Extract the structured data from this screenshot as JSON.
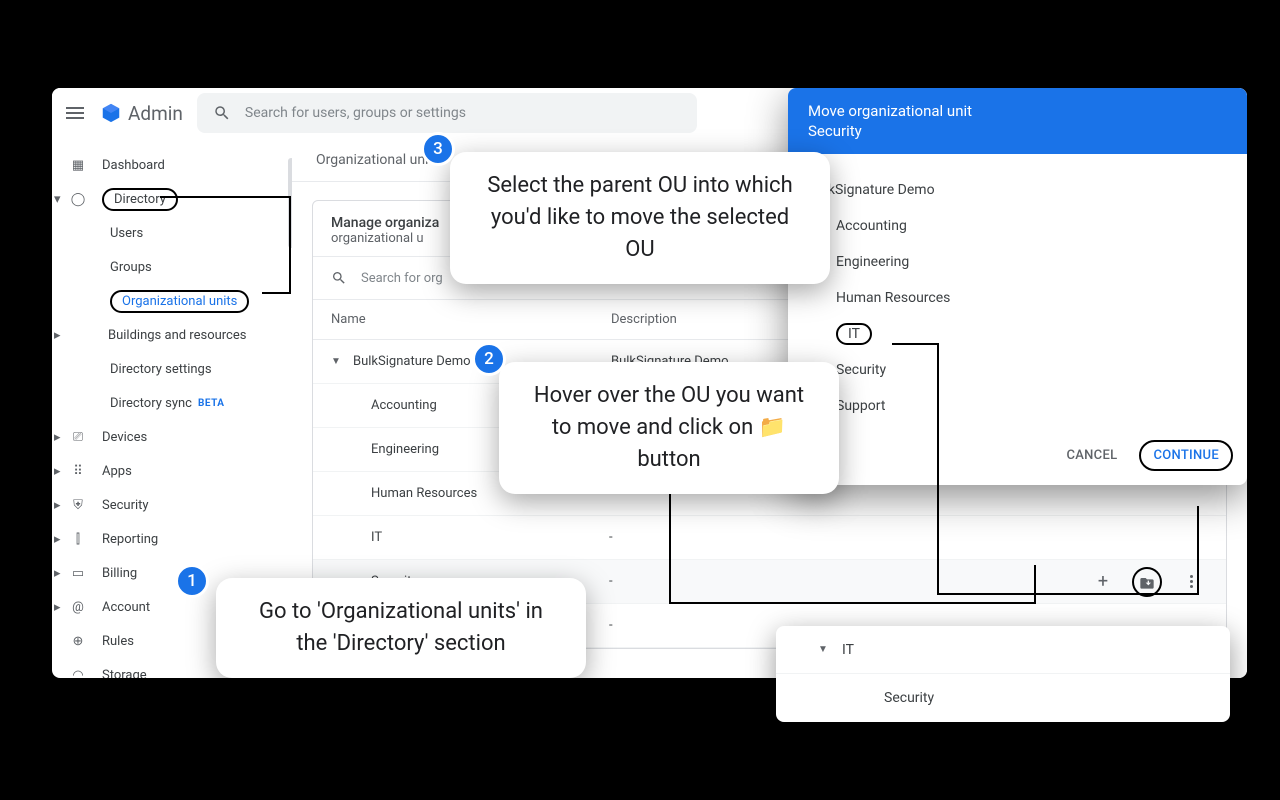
{
  "header": {
    "brand": "Admin",
    "search_placeholder": "Search for users, groups or settings"
  },
  "sidebar": {
    "items": [
      {
        "label": "Dashboard"
      },
      {
        "label": "Directory"
      },
      {
        "label": "Users"
      },
      {
        "label": "Groups"
      },
      {
        "label": "Organizational units"
      },
      {
        "label": "Buildings and resources"
      },
      {
        "label": "Directory settings"
      },
      {
        "label": "Directory sync",
        "badge": "BETA"
      },
      {
        "label": "Devices"
      },
      {
        "label": "Apps"
      },
      {
        "label": "Security"
      },
      {
        "label": "Reporting"
      },
      {
        "label": "Billing"
      },
      {
        "label": "Account"
      },
      {
        "label": "Rules"
      },
      {
        "label": "Storage"
      }
    ]
  },
  "main": {
    "breadcrumb": "Organizational units",
    "panel_title": "Manage organiza",
    "panel_sub": "organizational u",
    "search_placeholder": "Search for org",
    "cols": {
      "name": "Name",
      "desc": "Description"
    },
    "rows": [
      {
        "name": "BulkSignature Demo",
        "desc": "BulkSignature Demo",
        "level": 1,
        "exp": true
      },
      {
        "name": "Accounting",
        "desc": "",
        "level": 2
      },
      {
        "name": "Engineering",
        "desc": "",
        "level": 2
      },
      {
        "name": "Human Resources",
        "desc": "",
        "level": 2
      },
      {
        "name": "IT",
        "desc": "-",
        "level": 2
      },
      {
        "name": "Security",
        "desc": "-",
        "level": 2,
        "hover": true
      },
      {
        "name": "",
        "desc": "-",
        "level": 2
      }
    ]
  },
  "dialog": {
    "title": "Move organizational unit",
    "subtitle": "Security",
    "items": [
      "BulkSignature Demo",
      "Accounting",
      "Engineering",
      "Human Resources",
      "IT",
      "Security",
      "Support"
    ],
    "cancel": "CANCEL",
    "continue": "CONTINUE"
  },
  "callouts": {
    "c1": "Go to 'Organizational units' in the 'Directory' section",
    "c2": "Hover over the OU you want to move and click on 📁 button",
    "c3": "Select the parent OU into which you'd like to move the selected OU"
  },
  "mini": {
    "parent": "IT",
    "child": "Security"
  }
}
